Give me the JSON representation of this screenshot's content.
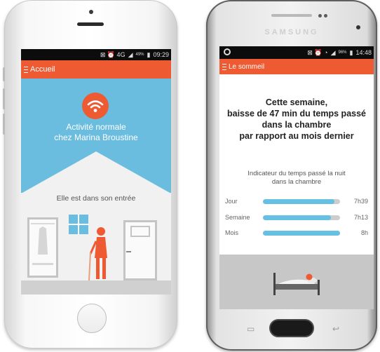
{
  "left_phone": {
    "status": {
      "icons": "⊠ ⏰ 4G",
      "battery_pct": "49%",
      "time": "09:29"
    },
    "appbar_title": "Accueil",
    "activity_line1": "Activité normale",
    "activity_line2": "chez Marina Broustine",
    "location_text": "Elle est dans son entrée"
  },
  "right_phone": {
    "brand": "SAMSUNG",
    "status": {
      "icons": "⊠ ⏰ ◔",
      "battery_pct": "96%",
      "time": "14:48"
    },
    "appbar_title": "Le sommeil",
    "headline": [
      "Cette semaine,",
      "baisse de 47 min du temps passé",
      "dans la chambre",
      "par rapport au mois dernier"
    ],
    "indicator_title": [
      "Indicateur du temps passé la nuit",
      "dans la chambre"
    ],
    "bars": [
      {
        "label": "Jour",
        "value": "7h39",
        "fill": 0.93
      },
      {
        "label": "Semaine",
        "value": "7h13",
        "fill": 0.88
      },
      {
        "label": "Mois",
        "value": "8h",
        "fill": 1.0
      }
    ]
  },
  "colors": {
    "accent": "#ee5a32",
    "sky": "#6bbde0",
    "bar_fill": "#65c0e4",
    "bar_track": "#cdcdcd"
  },
  "icons": [
    "menu-icon",
    "wifi-icon",
    "battery-icon",
    "signal-icon",
    "alarm-icon",
    "bed-icon",
    "person-with-cane-icon"
  ]
}
